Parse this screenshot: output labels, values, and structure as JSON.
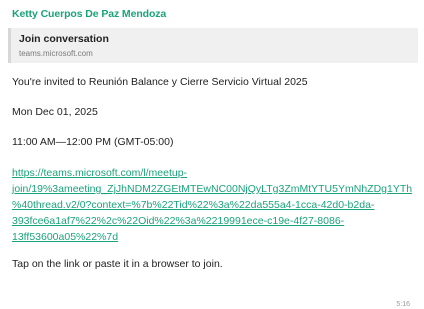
{
  "message": {
    "sender": "Ketty Cuerpos De Paz Mendoza",
    "preview": {
      "title": "Join conversation",
      "domain": "teams.microsoft.com"
    },
    "invite_text": "You're invited to Reunión Balance y Cierre Servicio Virtual 2025",
    "date": "Mon Dec 01, 2025",
    "time": "11:00 AM—12:00 PM (GMT-05:00)",
    "link_lines": [
      "https://teams.microsoft.com/l/meetup-",
      "join/19%3ameeting_ZjJhNDM2ZGEtMTEwNC00NjQyLTg3ZmMtYTU5YmNhZDg1YTh",
      "%40thread.v2/0?context=%7b%22Tid%22%3a%22da555a4-1cca-42d0-b2da-",
      "393fce6a1af7%22%2c%22Oid%22%3a%2219991ece-c19e-4f27-8086-",
      "13ff53600a05%22%7d"
    ],
    "footer": "Tap on the link or paste it in a browser to join.",
    "timestamp": "5:16"
  },
  "colors": {
    "accent": "#1aa37a",
    "preview_bg": "#f0f0f0",
    "text": "#222222"
  }
}
